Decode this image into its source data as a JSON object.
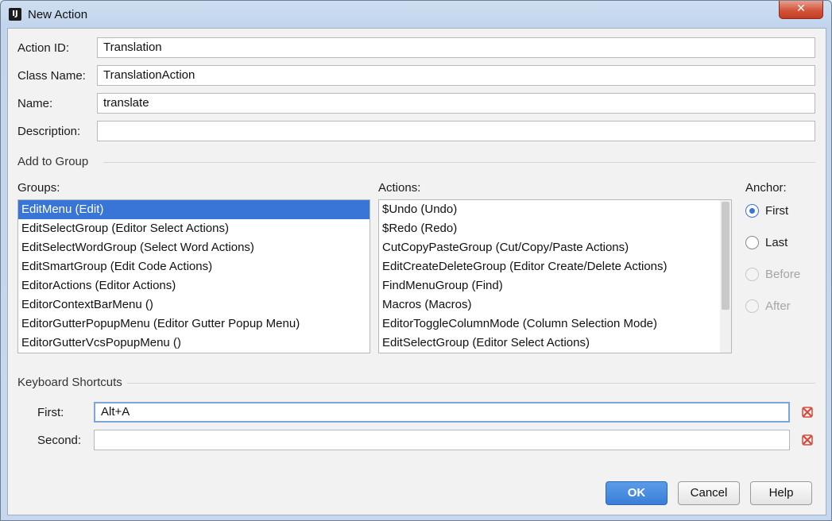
{
  "window": {
    "title": "New Action",
    "close_glyph": "✕"
  },
  "form": {
    "action_id": {
      "label": "Action ID:",
      "value": "Translation"
    },
    "class_name": {
      "label": "Class Name:",
      "value": "TranslationAction"
    },
    "name": {
      "label": "Name:",
      "value": "translate"
    },
    "description": {
      "label": "Description:",
      "value": ""
    }
  },
  "add_to_group": {
    "title": "Add to Group",
    "groups_label": "Groups:",
    "groups": [
      "EditMenu (Edit)",
      "EditSelectGroup (Editor Select Actions)",
      "EditSelectWordGroup (Select Word Actions)",
      "EditSmartGroup (Edit Code Actions)",
      "EditorActions (Editor Actions)",
      "EditorContextBarMenu ()",
      "EditorGutterPopupMenu (Editor Gutter Popup Menu)",
      "EditorGutterVcsPopupMenu ()"
    ],
    "selected_group": "EditMenu (Edit)",
    "actions_label": "Actions:",
    "actions": [
      "$Undo (Undo)",
      "$Redo (Redo)",
      "CutCopyPasteGroup (Cut/Copy/Paste Actions)",
      "EditCreateDeleteGroup (Editor Create/Delete Actions)",
      "FindMenuGroup (Find)",
      "Macros (Macros)",
      "EditorToggleColumnMode (Column Selection Mode)",
      "EditSelectGroup (Editor Select Actions)"
    ],
    "anchor_label": "Anchor:",
    "anchors": [
      {
        "label": "First",
        "checked": true,
        "enabled": true
      },
      {
        "label": "Last",
        "checked": false,
        "enabled": true
      },
      {
        "label": "Before",
        "checked": false,
        "enabled": false
      },
      {
        "label": "After",
        "checked": false,
        "enabled": false
      }
    ]
  },
  "shortcuts": {
    "title": "Keyboard Shortcuts",
    "first": {
      "label": "First:",
      "value": "Alt+A"
    },
    "second": {
      "label": "Second:",
      "value": ""
    }
  },
  "buttons": {
    "ok": "OK",
    "cancel": "Cancel",
    "help": "Help"
  },
  "colors": {
    "selection": "#3875d7",
    "accent_red": "#d84a3a"
  }
}
